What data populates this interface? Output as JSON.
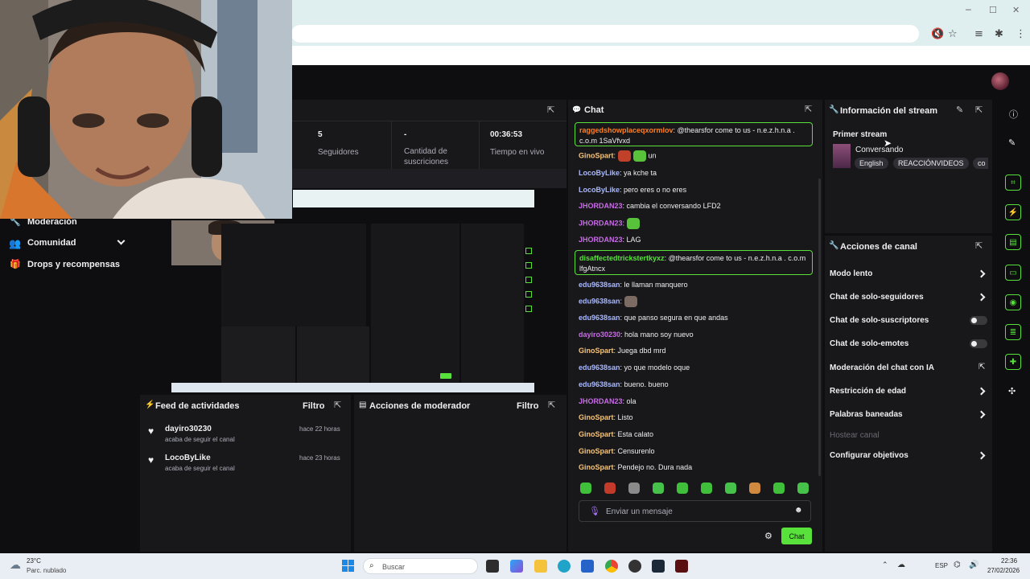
{
  "browser": {
    "win_min": "─",
    "win_max": "☐",
    "win_close": "✕"
  },
  "stats": [
    {
      "value": "5",
      "label": "Seguidores"
    },
    {
      "value": "-",
      "label": "Cantidad de suscriciones"
    },
    {
      "value": "00:36:53",
      "label": "Tiempo en vivo"
    }
  ],
  "sidebar": {
    "items": [
      {
        "label": "Moderación"
      },
      {
        "label": "Comunidad"
      },
      {
        "label": "Drops y recompensas"
      }
    ]
  },
  "chat": {
    "title": "Chat",
    "messages": [
      {
        "user": "raggedshowplaceqxormlov",
        "text": ": @thearsfor come to us - n.e.z.h.n.a . c.o.m 1SaVfvxd",
        "color": "#ff7f24",
        "highlight": true
      },
      {
        "user": "GinoSpart",
        "text": ": ",
        "after": "un",
        "color": "#f5c47a",
        "emotes": 2
      },
      {
        "user": "LocoByLike",
        "text": ": ya kche ta",
        "color": "#a9b8ff"
      },
      {
        "user": "LocoByLike",
        "text": ": pero eres o no eres",
        "color": "#a9b8ff"
      },
      {
        "user": "JHORDAN23",
        "text": ": cambia el conversando LFD2",
        "color": "#c86be6"
      },
      {
        "user": "JHORDAN23",
        "text": ": ",
        "color": "#c86be6",
        "emotes": 1
      },
      {
        "user": "JHORDAN23",
        "text": ": LAG",
        "color": "#c86be6"
      },
      {
        "user": "disaffectedtrickstertkyxz",
        "text": ": @thearsfor come to us - n.e.z.h.n.a . c.o.m lfgAtncx",
        "color": "#57e13a",
        "highlight": true
      },
      {
        "user": "edu9638san",
        "text": ": le llaman manquero",
        "color": "#a9b8ff"
      },
      {
        "user": "edu9638san",
        "text": ": ",
        "color": "#a9b8ff",
        "emotes": 1
      },
      {
        "user": "edu9638san",
        "text": ": que panso segura en que andas",
        "color": "#a9b8ff"
      },
      {
        "user": "dayiro30230",
        "text": ": hola mano soy nuevo",
        "color": "#c86be6"
      },
      {
        "user": "GinoSpart",
        "text": ": Juega dbd mrd",
        "color": "#f5c47a"
      },
      {
        "user": "edu9638san",
        "text": ": yo que modelo oque",
        "color": "#a9b8ff"
      },
      {
        "user": "edu9638san",
        "text": ": bueno. bueno",
        "color": "#a9b8ff"
      },
      {
        "user": "JHORDAN23",
        "text": ": ola",
        "color": "#c86be6"
      },
      {
        "user": "GinoSpart",
        "text": ": Listo",
        "color": "#f5c47a"
      },
      {
        "user": "GinoSpart",
        "text": ": Esta calato",
        "color": "#f5c47a"
      },
      {
        "user": "GinoSpart",
        "text": ": Censurenlo",
        "color": "#f5c47a"
      },
      {
        "user": "GinoSpart",
        "text": ": Pendejo no. Dura nada",
        "color": "#f5c47a"
      }
    ],
    "input_placeholder": "Enviar un mensaje",
    "send_label": "Chat"
  },
  "stream_info": {
    "title": "Información del stream",
    "stream_title": "Primer stream",
    "category": "Conversando",
    "tags": [
      "English",
      "REACCIÓNVIDEOS",
      "co"
    ]
  },
  "channel_actions": {
    "title": "Acciones de canal",
    "items": [
      {
        "label": "Modo lento",
        "control": "chevron"
      },
      {
        "label": "Chat de solo-seguidores",
        "control": "chevron"
      },
      {
        "label": "Chat de solo-suscriptores",
        "control": "toggle"
      },
      {
        "label": "Chat de solo-emotes",
        "control": "toggle"
      },
      {
        "label": "Moderación del chat con IA",
        "control": "external"
      },
      {
        "label": "Restricción de edad",
        "control": "chevron"
      },
      {
        "label": "Palabras baneadas",
        "control": "chevron"
      },
      {
        "label": "Hostear canal",
        "control": "none",
        "disabled": true
      },
      {
        "label": "Configurar objetivos",
        "control": "chevron"
      }
    ]
  },
  "activity_feed": {
    "title": "Feed de actividades",
    "filter": "Filtro",
    "items": [
      {
        "user": "dayiro30230",
        "action": "acaba de seguir el canal",
        "time": "hace 22 horas"
      },
      {
        "user": "LocoByLike",
        "action": "acaba de seguir el canal",
        "time": "hace 23 horas"
      }
    ]
  },
  "mod_actions": {
    "title": "Acciones de moderador",
    "filter": "Filtro"
  },
  "taskbar": {
    "weather_temp": "23°C",
    "weather_desc": "Parc. nublado",
    "search_placeholder": "Buscar",
    "lang": "ESP",
    "time": "22:36",
    "date": "27/02/2026"
  },
  "colors": {
    "accent": "#57e13a",
    "panel": "#18181b",
    "background": "#0e0e10"
  }
}
